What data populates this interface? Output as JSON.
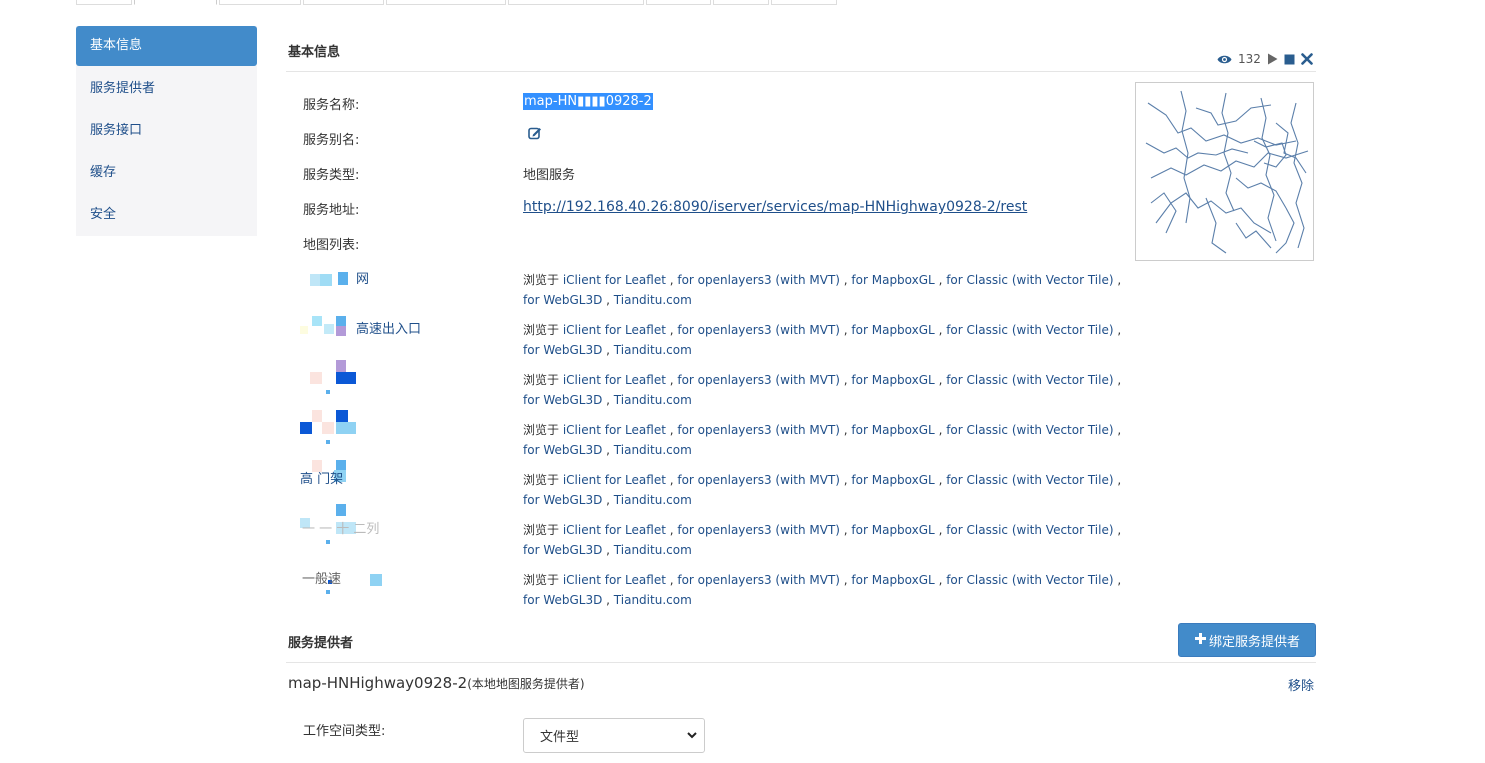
{
  "sidebar": {
    "items": [
      {
        "label": "基本信息",
        "active": true
      },
      {
        "label": "服务提供者",
        "active": false
      },
      {
        "label": "服务接口",
        "active": false
      },
      {
        "label": "缓存",
        "active": false
      },
      {
        "label": "安全",
        "active": false
      }
    ]
  },
  "basic_info": {
    "title": "基本信息",
    "view_count": "132",
    "service_name_label": "服务名称:",
    "service_name_value": "map-HN▮▮▮▮0928-2",
    "alias_label": "服务别名:",
    "type_label": "服务类型:",
    "type_value": "地图服务",
    "address_label": "服务地址:",
    "address_value": "http://192.168.40.26:8090/iserver/services/map-HNHighway0928-2/rest",
    "map_list_label": "地图列表:"
  },
  "browse": {
    "prefix": "浏览于",
    "links": [
      "iClient for Leaflet",
      "for openlayers3 (with MVT)",
      "for MapboxGL",
      "for Classic (with Vector Tile)",
      "for WebGL3D",
      "Tianditu.com"
    ]
  },
  "maps": [
    {
      "name": "网"
    },
    {
      "name": "高速出入口"
    },
    {
      "name": ""
    },
    {
      "name": ""
    },
    {
      "name": "高 门架"
    },
    {
      "name": "一 一 ⼗ 二列"
    },
    {
      "name": "一般速"
    }
  ],
  "providers": {
    "title": "服务提供者",
    "bind_button": "绑定服务提供者",
    "provider_name": "map-HNHighway0928-2",
    "provider_type": "(本地地图服务提供者)",
    "remove_label": "移除",
    "workspace_type_label": "工作空间类型:",
    "workspace_type_value": "文件型"
  },
  "colors": {
    "accent": "#428bca",
    "link": "#1f4f8a",
    "selection": "#3390ff"
  }
}
